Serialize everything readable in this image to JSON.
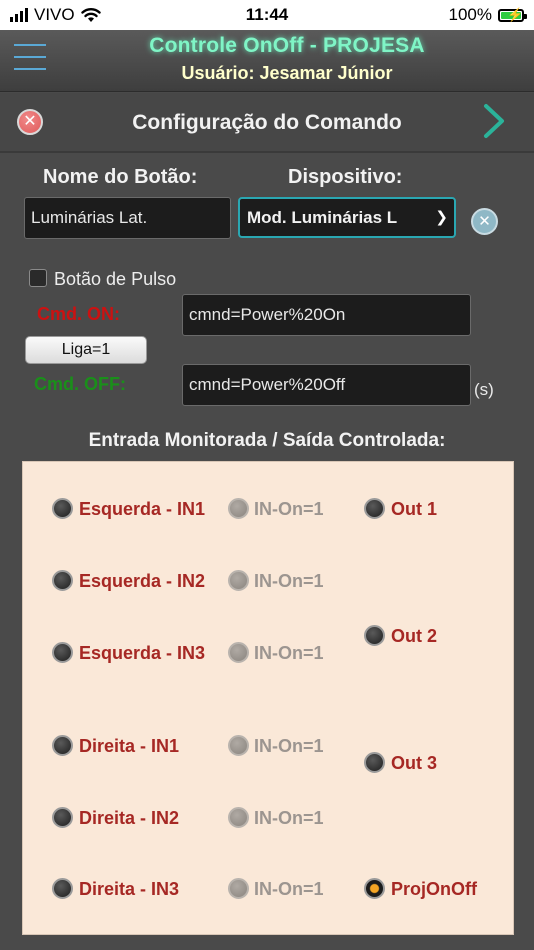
{
  "status_bar": {
    "carrier": "VIVO",
    "time": "11:44",
    "battery": "100%"
  },
  "header": {
    "title": "Controle OnOff - PROJESA",
    "user": "Usuário: Jesamar Júnior"
  },
  "sub_header": {
    "title": "Configuração do Comando"
  },
  "form": {
    "name_label": "Nome do Botão:",
    "name_value": "Luminárias Lat.",
    "device_label": "Dispositivo:",
    "device_value": "Mod. Luminárias L",
    "pulse_label": "Botão de Pulso",
    "pulse_checked": false,
    "cmd_on_label": "Cmd. ON:",
    "cmd_on_value": "cmnd=Power%20On",
    "cmd_off_label": "Cmd. OFF:",
    "cmd_off_value": "cmnd=Power%20Off",
    "liga_button": "Liga=1",
    "unit": "(s)"
  },
  "section_title": "Entrada Monitorada / Saída Controlada:",
  "inputs": [
    {
      "label": "Esquerda - IN1",
      "on_label": "IN-On=1"
    },
    {
      "label": "Esquerda - IN2",
      "on_label": "IN-On=1"
    },
    {
      "label": "Esquerda - IN3",
      "on_label": "IN-On=1"
    },
    {
      "label": "Direita - IN1",
      "on_label": "IN-On=1"
    },
    {
      "label": "Direita - IN2",
      "on_label": "IN-On=1"
    },
    {
      "label": "Direita - IN3",
      "on_label": "IN-On=1"
    }
  ],
  "outputs": [
    {
      "label": "Out 1",
      "selected": false
    },
    {
      "label": "Out 2",
      "selected": false
    },
    {
      "label": "Out 3",
      "selected": false
    },
    {
      "label": "ProjOnOff",
      "selected": true
    }
  ],
  "colors": {
    "title_glow": "#7ff5c6",
    "user_text": "#ffffcc",
    "cmd_on": "#cc1111",
    "cmd_off": "#1a8f1a",
    "panel_bg": "#fae8d8",
    "io_label": "#a62824",
    "selected_dot": "#f5a524"
  }
}
